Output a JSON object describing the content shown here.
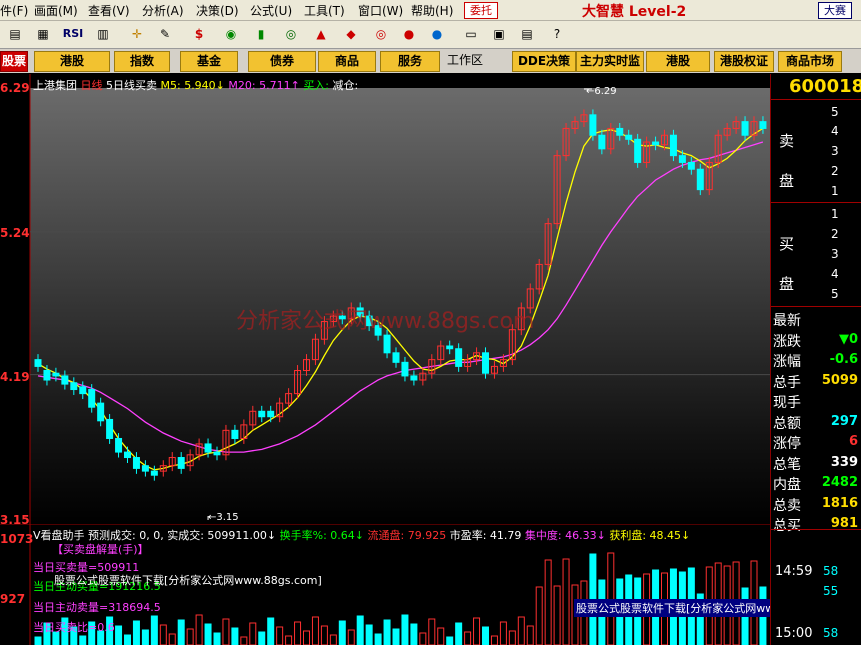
{
  "menu": {
    "items": [
      "件(F)",
      "画面(M)",
      "查看(V)",
      "分析(A)",
      "决策(D)",
      "公式(U)",
      "工具(T)",
      "窗口(W)",
      "帮助(H)"
    ],
    "trade": "委托",
    "brand": "大智慧",
    "brand_sub": "Level-2",
    "contest": "大赛"
  },
  "toolbar": {
    "icons": [
      "window-icon",
      "grid-icon",
      "rsi-icon",
      "table-icon",
      "crosshair-icon",
      "ruler-icon",
      "dollar-icon",
      "switch-icon",
      "bars-icon",
      "binoculars-icon",
      "alert-icon",
      "stop-icon",
      "ring-icon",
      "disc-icon",
      "copy-icon",
      "layout-icon",
      "layers-icon",
      "help-icon"
    ],
    "rsi_label": "RSI"
  },
  "categories": {
    "items": [
      "股票",
      "港股",
      "指数",
      "基金",
      "债券",
      "商品",
      "服务",
      "工作区",
      "DDE决策",
      "主力实时监控",
      "港股",
      "港股权证",
      "商品市场"
    ]
  },
  "chart_info": {
    "name": "上港集团",
    "period": "日线",
    "indicator": "5日线买卖",
    "m5": "M5: 5.940↓",
    "m20": "M20: 5.711↑",
    "buy": "买入:",
    "sell": "减仓:"
  },
  "price_axis": {
    "labels": [
      "6.29",
      "5.24",
      "4.19",
      "3.15"
    ],
    "high_label": "←6.29",
    "low_label": "←3.15"
  },
  "watermark": "分析家公式网www.88gs.com",
  "indicator_line": {
    "title": "V看盘助手 预测成交: 0, 0,",
    "actual": "实成交: 509911.00↓",
    "turnover": "换手率%: 0.64↓",
    "float": "流通盘: 79.925",
    "pe": "市盈率: 41.79",
    "conc": "集中度: 46.33↓",
    "profit": "获利盘: 48.45↓"
  },
  "sub_axis": {
    "labels": [
      "1073",
      "927"
    ]
  },
  "sub_text": {
    "lines": [
      "【买卖盘解量(手)】",
      "当日买卖量=509911",
      "当日主动买量=191216.5",
      "当日主动卖量=318694.5",
      "当日买卖比=0.6"
    ],
    "wm2": "股票公式股票软件下载[分析家公式网www.88gs.com]",
    "wm3": "股票公式股票软件下载[分析家公式网www.88gs.com]"
  },
  "right_panel": {
    "code": "600018",
    "sell_side": "卖盘",
    "buy_side": "买盘",
    "sell_levels": [
      "5",
      "4",
      "3",
      "2",
      "1"
    ],
    "buy_levels": [
      "1",
      "2",
      "3",
      "4",
      "5"
    ],
    "stats": [
      {
        "label": "最新",
        "value": "",
        "color": "#fff"
      },
      {
        "label": "涨跌",
        "value": "▼0",
        "color": "#00ff00"
      },
      {
        "label": "涨幅",
        "value": "-0.6",
        "color": "#00ff00"
      },
      {
        "label": "总手",
        "value": "5099",
        "color": "#ffdd00"
      },
      {
        "label": "现手",
        "value": "",
        "color": "#fff"
      },
      {
        "label": "总额",
        "value": "297",
        "color": "#00ffff"
      },
      {
        "label": "涨停",
        "value": "6",
        "color": "#ff3030"
      },
      {
        "label": "总笔",
        "value": "339",
        "color": "#fff"
      },
      {
        "label": "内盘",
        "value": "2482",
        "color": "#00ff00"
      },
      {
        "label": "总卖",
        "value": "1816",
        "color": "#ffdd00"
      },
      {
        "label": "总买",
        "value": "981",
        "color": "#ffdd00"
      }
    ],
    "ticks": [
      {
        "time": "14:59",
        "value": "58"
      },
      {
        "time": "",
        "value": "55"
      },
      {
        "time": "15:00",
        "value": "58"
      }
    ]
  },
  "chart_data": {
    "type": "candlestick",
    "ylim": [
      3.15,
      6.29
    ],
    "candles_open": [
      4.3,
      4.22,
      4.2,
      4.18,
      4.13,
      4.1,
      4.08,
      3.98,
      3.86,
      3.72,
      3.62,
      3.58,
      3.52,
      3.48,
      3.48,
      3.52,
      3.58,
      3.52,
      3.6,
      3.68,
      3.62,
      3.6,
      3.78,
      3.72,
      3.82,
      3.92,
      3.92,
      3.88,
      3.98,
      4.05,
      4.22,
      4.3,
      4.45,
      4.58,
      4.62,
      4.6,
      4.68,
      4.62,
      4.55,
      4.48,
      4.35,
      4.28,
      4.18,
      4.15,
      4.2,
      4.3,
      4.4,
      4.38,
      4.25,
      4.3,
      4.35,
      4.2,
      4.25,
      4.3,
      4.52,
      4.68,
      4.82,
      5.0,
      5.3,
      5.8,
      6.0,
      6.05,
      6.1,
      5.95,
      5.85,
      6.0,
      5.95,
      5.92,
      5.75,
      5.9,
      5.88,
      5.95,
      5.8,
      5.75,
      5.7,
      5.55,
      5.75,
      5.95,
      6.0,
      6.05,
      5.95,
      6.05
    ],
    "candles_close": [
      4.25,
      4.15,
      4.18,
      4.12,
      4.08,
      4.05,
      3.95,
      3.85,
      3.72,
      3.62,
      3.58,
      3.5,
      3.48,
      3.45,
      3.52,
      3.58,
      3.5,
      3.6,
      3.68,
      3.62,
      3.6,
      3.78,
      3.72,
      3.82,
      3.92,
      3.88,
      3.88,
      3.98,
      4.05,
      4.22,
      4.3,
      4.45,
      4.58,
      4.62,
      4.6,
      4.68,
      4.62,
      4.55,
      4.48,
      4.35,
      4.28,
      4.18,
      4.15,
      4.2,
      4.3,
      4.4,
      4.38,
      4.25,
      4.3,
      4.35,
      4.2,
      4.25,
      4.3,
      4.52,
      4.68,
      4.82,
      5.0,
      5.3,
      5.8,
      6.0,
      6.05,
      6.1,
      5.95,
      5.85,
      6.0,
      5.95,
      5.92,
      5.75,
      5.9,
      5.88,
      5.95,
      5.8,
      5.75,
      5.7,
      5.55,
      5.75,
      5.95,
      6.0,
      6.05,
      5.95,
      6.05,
      6.0
    ],
    "ma5": [
      4.27,
      4.23,
      4.2,
      4.16,
      4.13,
      4.08,
      4.01,
      3.93,
      3.82,
      3.72,
      3.64,
      3.57,
      3.52,
      3.49,
      3.5,
      3.52,
      3.53,
      3.55,
      3.59,
      3.61,
      3.62,
      3.65,
      3.68,
      3.72,
      3.78,
      3.82,
      3.86,
      3.9,
      3.95,
      4.02,
      4.11,
      4.21,
      4.33,
      4.44,
      4.52,
      4.59,
      4.62,
      4.61,
      4.58,
      4.53,
      4.45,
      4.37,
      4.29,
      4.23,
      4.22,
      4.25,
      4.29,
      4.3,
      4.3,
      4.33,
      4.31,
      4.3,
      4.27,
      4.32,
      4.4,
      4.55,
      4.73,
      4.92,
      5.19,
      5.45,
      5.68,
      5.87,
      5.96,
      5.98,
      5.99,
      5.97,
      5.93,
      5.88,
      5.87,
      5.88,
      5.86,
      5.85,
      5.82,
      5.8,
      5.76,
      5.71,
      5.74,
      5.78,
      5.84,
      5.91,
      5.96,
      6.0
    ],
    "ma20": [
      4.18,
      4.17,
      4.16,
      4.15,
      4.13,
      4.11,
      4.09,
      4.06,
      4.02,
      3.98,
      3.94,
      3.89,
      3.84,
      3.8,
      3.76,
      3.73,
      3.7,
      3.68,
      3.66,
      3.64,
      3.63,
      3.62,
      3.62,
      3.62,
      3.63,
      3.64,
      3.66,
      3.68,
      3.71,
      3.74,
      3.78,
      3.82,
      3.87,
      3.92,
      3.97,
      4.02,
      4.07,
      4.11,
      4.15,
      4.18,
      4.2,
      4.22,
      4.23,
      4.24,
      4.25,
      4.26,
      4.27,
      4.28,
      4.28,
      4.29,
      4.3,
      4.31,
      4.32,
      4.34,
      4.37,
      4.41,
      4.46,
      4.52,
      4.6,
      4.7,
      4.81,
      4.92,
      5.03,
      5.14,
      5.24,
      5.33,
      5.42,
      5.5,
      5.56,
      5.62,
      5.66,
      5.7,
      5.73,
      5.75,
      5.77,
      5.78,
      5.8,
      5.82,
      5.84,
      5.86,
      5.88,
      5.9
    ]
  }
}
